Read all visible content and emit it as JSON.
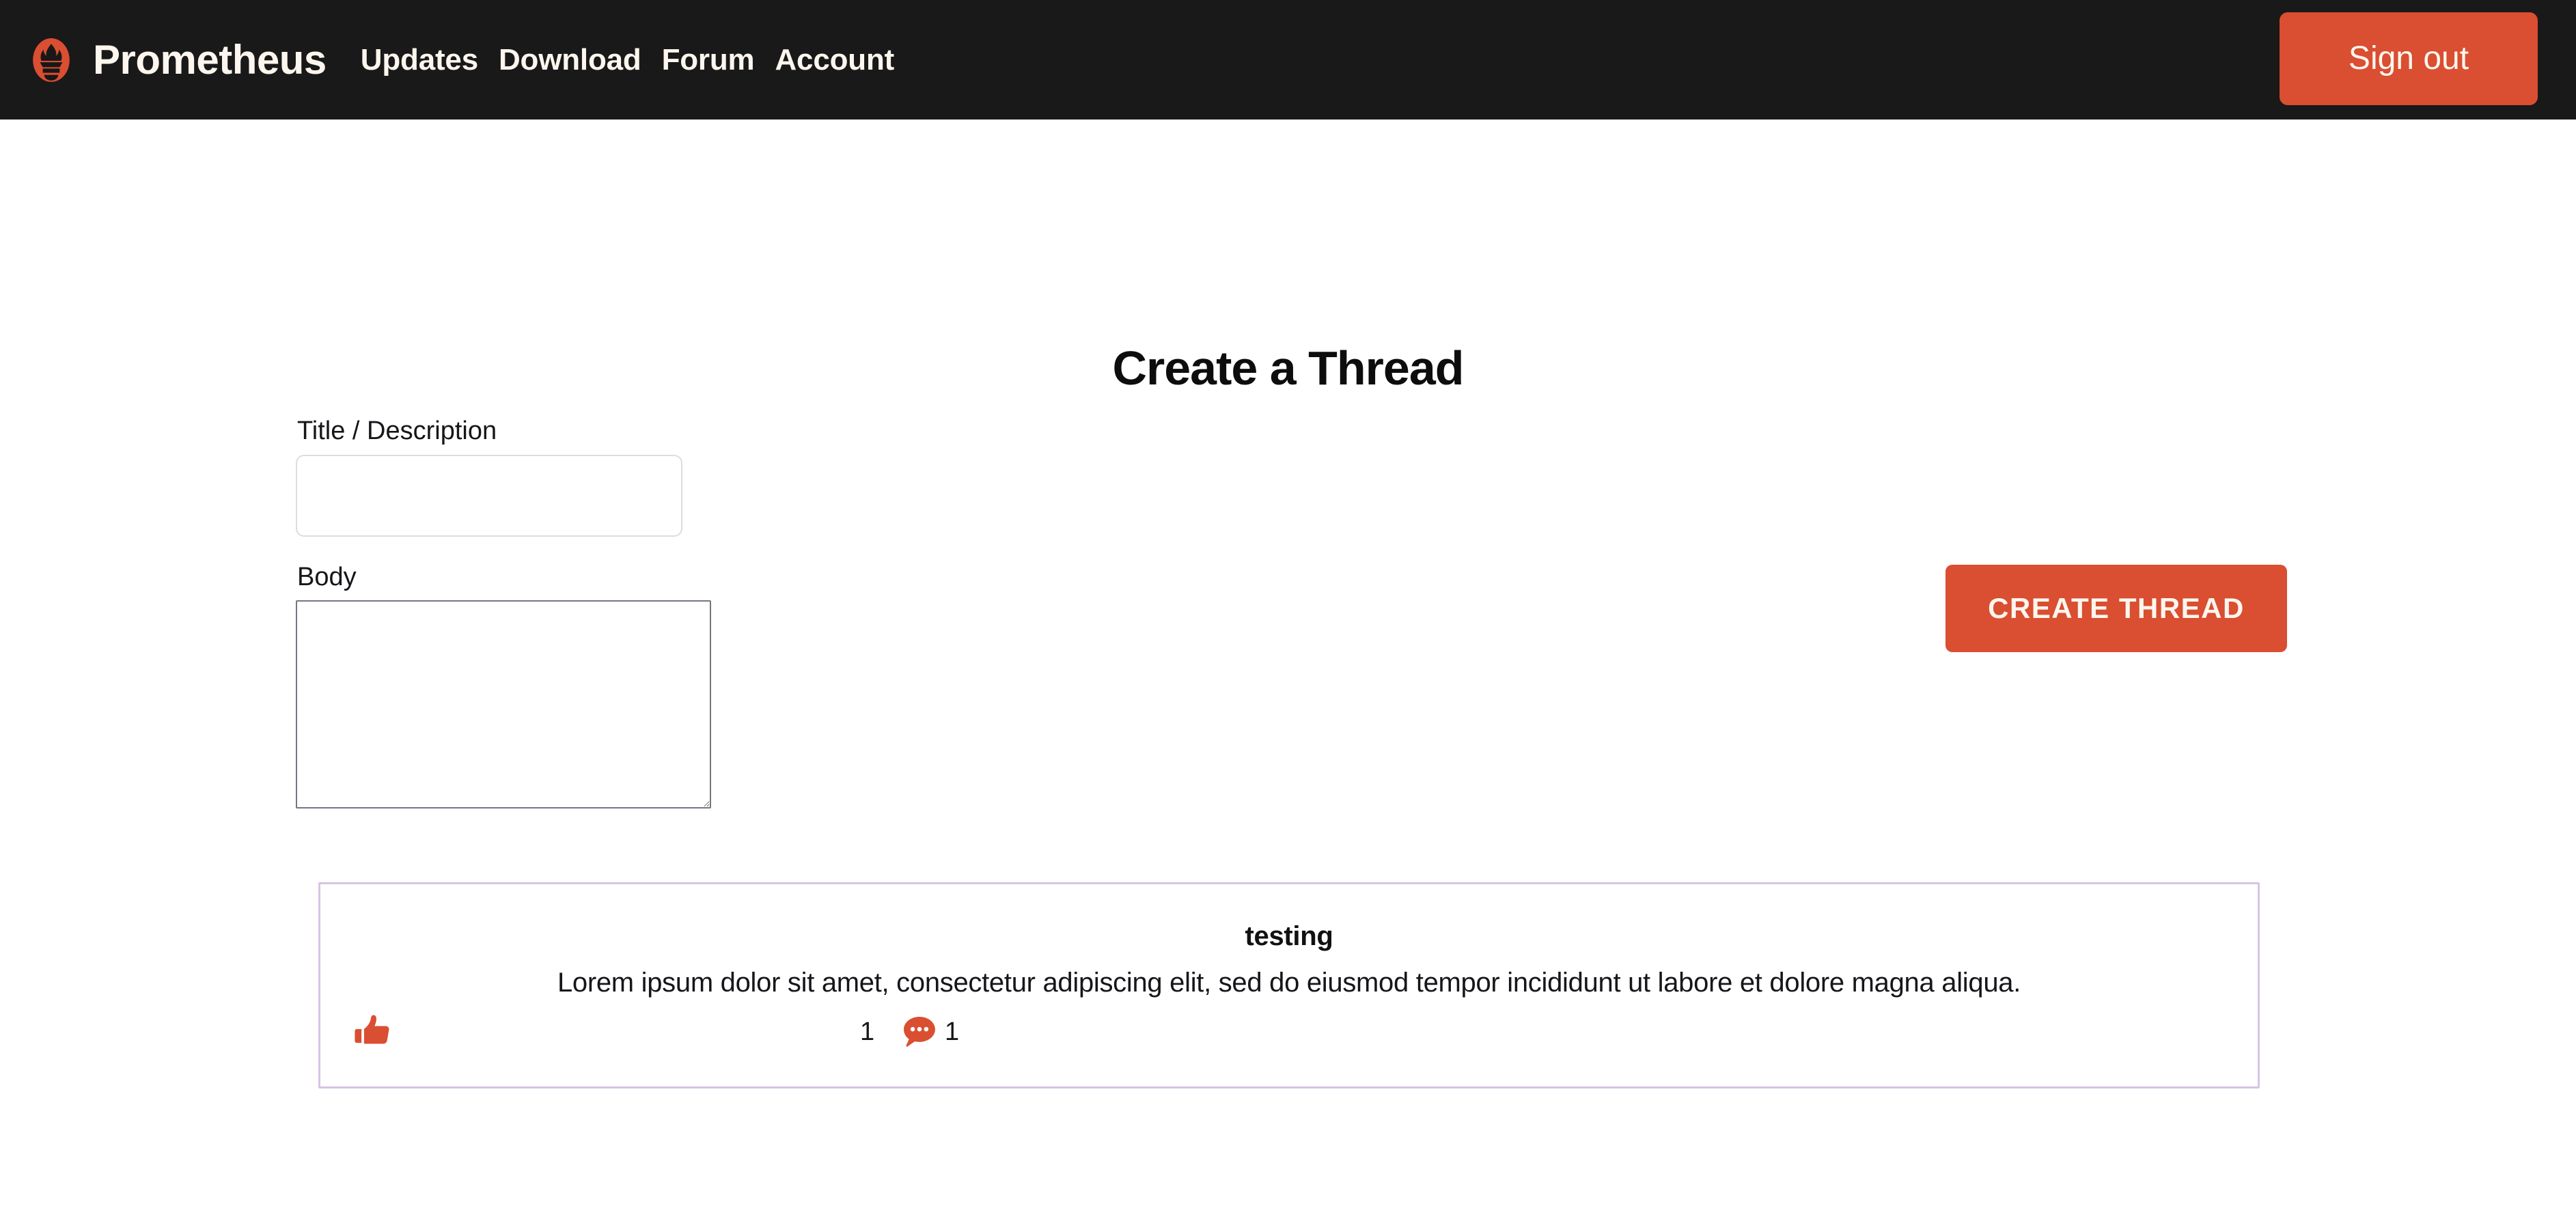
{
  "navbar": {
    "logo_icon": "prometheus-torch-icon",
    "brand": "Prometheus",
    "links": [
      {
        "label": "Updates"
      },
      {
        "label": "Download"
      },
      {
        "label": "Forum"
      },
      {
        "label": "Account"
      }
    ],
    "signout_label": "Sign out",
    "background_color": "#191919",
    "accent_color": "#da4e31",
    "text_color": "#fdf6ee"
  },
  "page": {
    "title": "Create a Thread"
  },
  "form": {
    "title_label": "Title / Description",
    "title_value": "",
    "title_placeholder": "",
    "body_label": "Body",
    "body_value": "",
    "body_placeholder": "",
    "submit_label": "CREATE THREAD"
  },
  "threads": [
    {
      "title": "testing",
      "body": "Lorem ipsum dolor sit amet, consectetur adipiscing elit, sed do eiusmod tempor incididunt ut labore et dolore magna aliqua.",
      "like_icon": "thumbs-up-icon",
      "like_count": "1",
      "comment_icon": "comment-bubble-icon",
      "comment_count": "1",
      "border_color": "#d5c5e4"
    }
  ]
}
